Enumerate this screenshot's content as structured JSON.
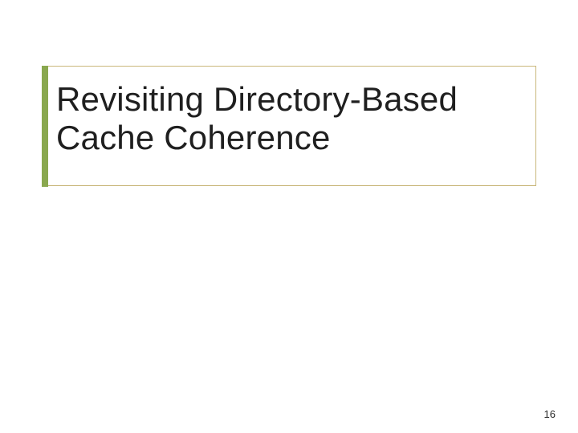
{
  "slide": {
    "title": "Revisiting Directory-Based Cache Coherence",
    "page_number": "16"
  },
  "colors": {
    "accent_green": "#8aa84f",
    "border_tan": "#c9b77a"
  }
}
